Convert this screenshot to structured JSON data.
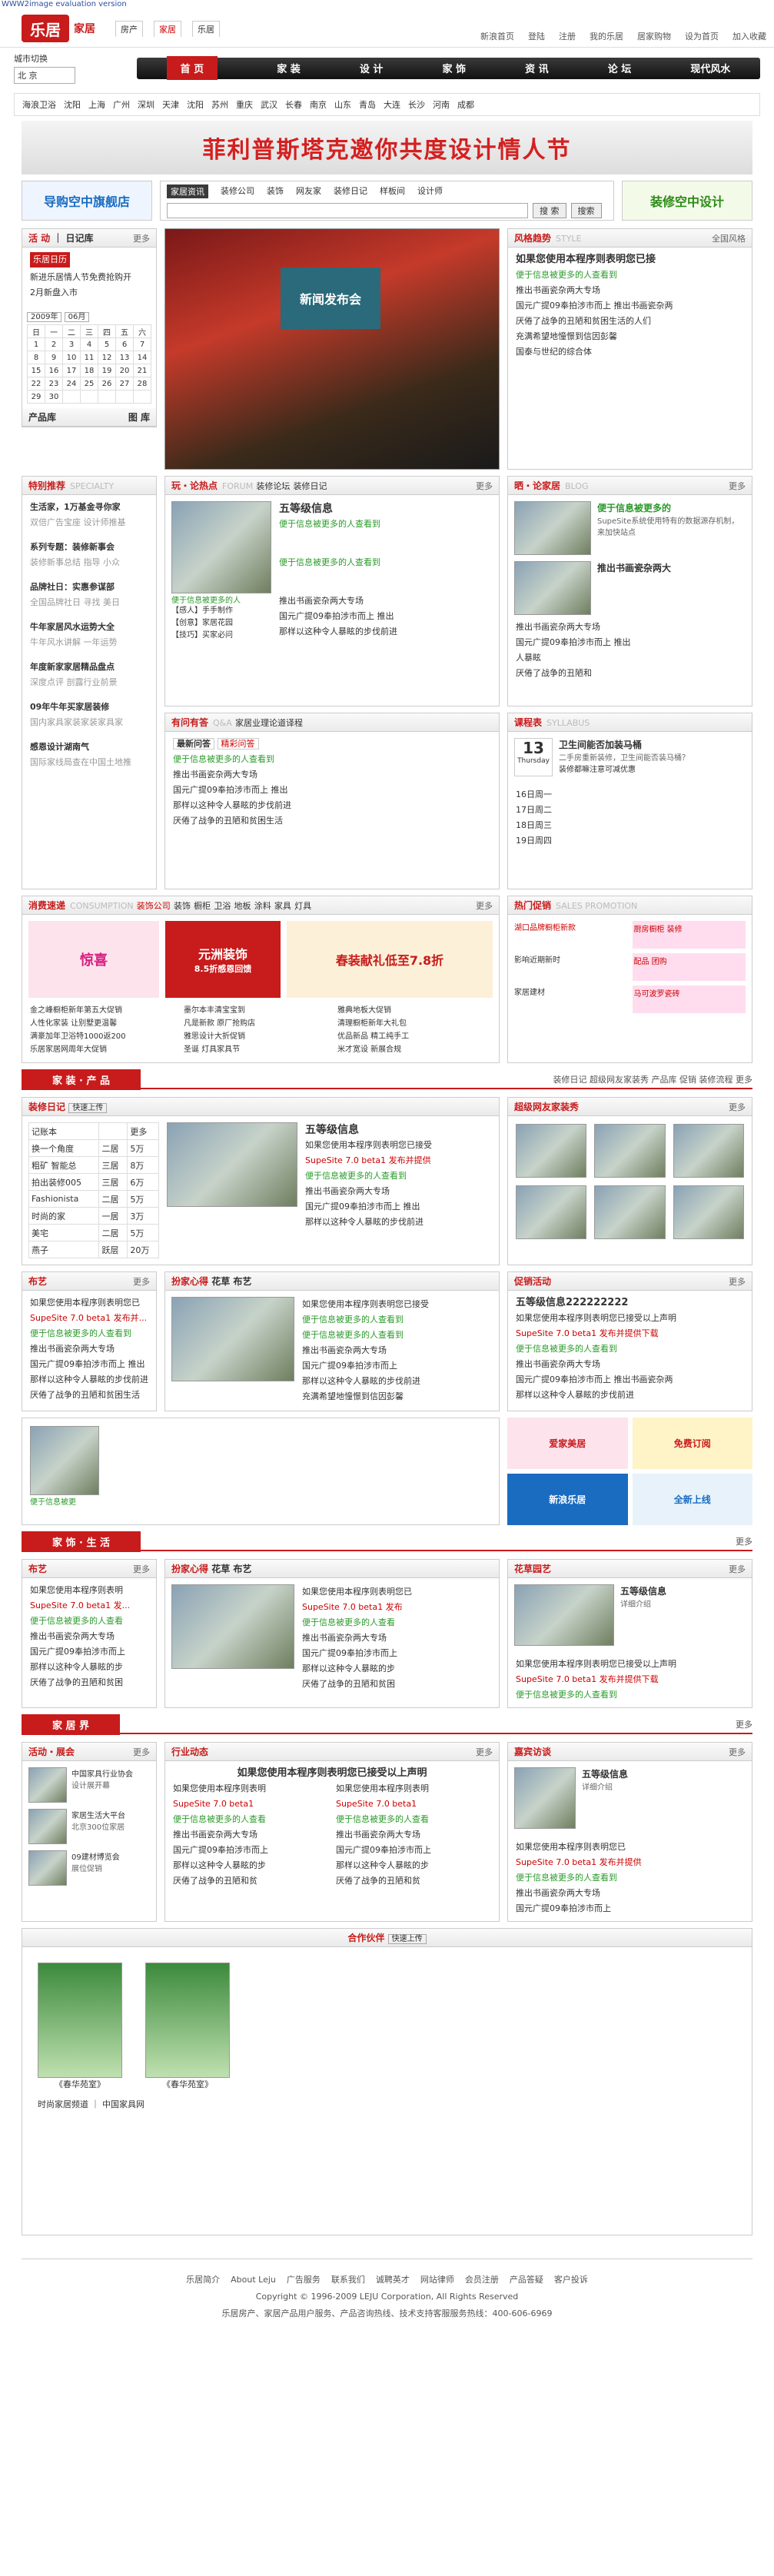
{
  "watermark": "WWW2image evaluation version",
  "logo": {
    "mark": "乐居",
    "sub": "家居"
  },
  "toptabs": [
    "房产",
    "家居",
    "乐居"
  ],
  "toplinks": [
    "新浪首页",
    "登陆",
    "注册",
    "我的乐居",
    "居家购物",
    "设为首页",
    "加入收藏"
  ],
  "region": {
    "label": "城市切换",
    "value": "北 京"
  },
  "mainnav": [
    "首 页",
    "家 装",
    "设 计",
    "家 饰",
    "资 讯",
    "论 坛",
    "现代风水"
  ],
  "cities": [
    "海浪卫浴",
    "沈阳",
    "上海",
    "广州",
    "深圳",
    "天津",
    "沈阳",
    "苏州",
    "重庆",
    "武汉",
    "长春",
    "南京",
    "山东",
    "青岛",
    "大连",
    "长沙",
    "河南",
    "成都"
  ],
  "banner": "菲利普斯塔克邀你共度设计情人节",
  "ads": {
    "left": "导购空中旗舰店",
    "right": "装修空中设计"
  },
  "search": {
    "tabs": [
      "家居资讯",
      "装修公司",
      "装饰",
      "网友家",
      "装修日记",
      "样板间",
      "设计师"
    ],
    "btn1": "搜 索",
    "btn2": "搜索"
  },
  "activity": {
    "title": "活 动",
    "title2": "日记库",
    "more": "更多",
    "tag": "乐居日历",
    "items": [
      "新进乐居情人节免费抢购开",
      "2月新盘入市"
    ],
    "month": "2009年",
    "mon": "06月",
    "week": [
      "日",
      "一",
      "二",
      "三",
      "四",
      "五",
      "六"
    ],
    "days": [
      [
        "1",
        "2",
        "3",
        "4",
        "5",
        "6",
        "7"
      ],
      [
        "8",
        "9",
        "10",
        "11",
        "12",
        "13",
        "14"
      ],
      [
        "15",
        "16",
        "17",
        "18",
        "19",
        "20",
        "21"
      ],
      [
        "22",
        "23",
        "24",
        "25",
        "26",
        "27",
        "28"
      ],
      [
        "29",
        "30",
        "",
        "",
        "",
        "",
        ""
      ]
    ],
    "cat1": "产品库",
    "cat2": "图 库"
  },
  "photo": {
    "screen": "新闻发布会"
  },
  "trend": {
    "title": "风格趋势",
    "en": "STYLE",
    "sel": "全国风格",
    "headline": "如果您使用本程序则表明您已接",
    "green": "便于信息被更多的人查看到",
    "items": [
      "推出书画瓷杂两大专场",
      "国元广提09奉拍涉市而上 推出书画瓷杂两",
      "厌倦了战争的丑陋和贫困生活的人们",
      "充满希望地憧憬到信因彭馨",
      "国泰与世纪的综合体"
    ]
  },
  "special": {
    "title": "特别推荐",
    "en": "SPECIALTY",
    "items": [
      {
        "h": "生活家，1万基金寻你家",
        "s": "双倍广告宝座 设计师推基"
      },
      {
        "h": "系列专题：装修新事会",
        "s": "装修新事总结 指导 小众"
      },
      {
        "h": "品牌社日：实惠参谋部",
        "s": "全国品牌社日 寻找 美日"
      },
      {
        "h": "牛年家居风水运势大全",
        "s": "牛年风水讲解 一年运势"
      },
      {
        "h": "年度新家家居精品盘点",
        "s": "深度点评 剖露行业前景"
      },
      {
        "h": "09年牛年买家居装修",
        "s": "国内家具家装家装家具家"
      },
      {
        "h": "感恩设计湖南气",
        "s": "国际家线局查在中国土地推"
      }
    ]
  },
  "forum": {
    "title": "玩・论热点",
    "en": "FORUM",
    "tabs": [
      "装修论坛",
      "装修日记"
    ],
    "more": "更多",
    "headline": "五等级信息",
    "green1": "便于信息被更多的人查看到",
    "green2": "便于信息被更多的人查看到",
    "imgcap": "便于信息被更多的人",
    "lines": [
      "【感人】手手制作",
      "【创意】家居花园",
      "【技巧】买家必问",
      "推出书画瓷杂两大专场",
      "国元广提09奉拍涉市而上 推出",
      "那样以这种令人暴眩的步伐前进"
    ]
  },
  "ask": {
    "title": "有问有答",
    "en": "Q&A",
    "tab": "家居业理论道译程",
    "btab1": "最新问答",
    "btab2": "精彩问答",
    "green": "便于信息被更多的人查看到",
    "items": [
      "推出书画瓷杂两大专场",
      "国元广提09奉拍涉市而上 推出",
      "那样以这种令人暴眩的步伐前进",
      "厌倦了战争的丑陋和贫困生活"
    ]
  },
  "design": {
    "title": "晒・论家居",
    "en": "BLOG",
    "more": "更多",
    "h1": "便于信息被更多的",
    "d1": "SupeSite系统使用特有的数据源存机制，来加快站点",
    "h2": "推出书画瓷杂两大",
    "items": [
      "推出书画瓷杂两大专场",
      "国元广提09奉拍涉市而上 推出",
      "人暴眩",
      "厌倦了战争的丑陋和",
      "充满希望地憧憬"
    ]
  },
  "class": {
    "title": "课程表",
    "en": "SYLLABUS",
    "day": "13",
    "wday": "Thursday",
    "head": "卫生间能否加装马桶",
    "desc": "二手房重新装修，卫生间能否装马桶？",
    "line": "装修都嘛注意可减优惠",
    "days": [
      "16日周一",
      "17日周二",
      "18日周三",
      "19日周四"
    ]
  },
  "consume": {
    "title": "消费速递",
    "en": "CONSUMPTION",
    "tabs": [
      "装饰公司",
      "装饰",
      "橱柜",
      "卫浴",
      "地板",
      "涂料",
      "家具",
      "灯具"
    ],
    "more": "更多",
    "b1": "惊喜",
    "b2": "元洲装饰",
    "b2s": "8.5折感恩回馈",
    "b3": "春装献礼低至7.8折",
    "items": [
      "金之峰橱柜新年第五大促销",
      "人性化家装 让别墅更温馨",
      "满豪加年卫浴特1000返200",
      "乐居家居网周年大促销",
      "墨尔本丰清宝宝到",
      "凡是新款 原厂抢购店",
      "雅思设计大折促销",
      "圣诞 灯具家具节",
      "雅典地板大促销",
      "清理橱柜新年大礼包",
      "优品新品 精工纯手工",
      "米才宽设 新展合规"
    ]
  },
  "hot": {
    "title": "热门促销",
    "en": "SALES PROMOTION",
    "items": [
      "湖口品牌橱柜新款",
      "厨房橱柜 装修",
      "影响近期新时",
      "配品 团购",
      "家居建材",
      "马可波罗瓷砖"
    ]
  },
  "sec1": {
    "title": "家 装 · 产 品",
    "links": "装修日记 超级网友家装秀 产品库 促销 装修流程",
    "more": "更多"
  },
  "diary": {
    "title": "装修日记",
    "btn": "快速上传",
    "table": [
      [
        "记账本",
        "",
        "更多"
      ],
      [
        "换一个角度",
        "二居",
        "5万"
      ],
      [
        "粗矿 智能总",
        "三居",
        "8万"
      ],
      [
        "拍出装修005",
        "三居",
        "6万"
      ],
      [
        "Fashionista",
        "二居",
        "5万"
      ],
      [
        "时尚的家",
        "一居",
        "3万"
      ],
      [
        "美宅",
        "二居",
        "5万"
      ],
      [
        "燕子",
        "跃层",
        "20万"
      ]
    ]
  },
  "fiveinfo": {
    "title": "五等级信息",
    "items": [
      "如果您使用本程序则表明您已接受",
      "SupeSite 7.0 beta1 发布并提供",
      "便于信息被更多的人查看到",
      "推出书画瓷杂两大专场",
      "国元广提09奉拍涉市而上 推出",
      "那样以这种令人暴眩的步伐前进"
    ]
  },
  "superstar": {
    "title": "超级网友家装秀",
    "more": "更多"
  },
  "fabric": {
    "title": "布艺",
    "more": "更多",
    "items": [
      "如果您使用本程序则表明您已",
      "SupeSite 7.0 beta1 发布并...",
      "便于信息被更多的人查看到",
      "推出书画瓷杂两大专场",
      "国元广提09奉拍涉市而上 推出",
      "那样以这种令人暴眩的步伐前进",
      "厌倦了战争的丑陋和贫困生活"
    ]
  },
  "heart": {
    "title": "扮家心得",
    "t2": "花草",
    "t3": "布艺",
    "items": [
      "如果您使用本程序则表明您已接受",
      "便于信息被更多的人查看到",
      "便于信息被更多的人查看到",
      "推出书画瓷杂两大专场",
      "国元广提09奉拍涉市而上",
      "那样以这种令人暴眩的步伐前进",
      "充满希望地憧憬到信因彭馨"
    ]
  },
  "promo": {
    "title": "促销活动",
    "more": "更多",
    "head": "五等级信息222222222",
    "items": [
      "如果您使用本程序则表明您已接受以上声明",
      "SupeSite 7.0 beta1 发布并提供下载",
      "便于信息被更多的人查看到",
      "推出书画瓷杂两大专场",
      "国元广提09奉拍涉市而上 推出书画瓷杂两",
      "那样以这种令人暴眩的步伐前进"
    ]
  },
  "smallgreen": "便于信息被更",
  "smallads": [
    "爱家美居",
    "免费订阅",
    "新浪乐居",
    "全新上线"
  ],
  "sec2": {
    "title": "家 饰 · 生 活",
    "more": "更多"
  },
  "life1": {
    "title": "布艺",
    "more": "更多",
    "items": [
      "如果您使用本程序则表明",
      "SupeSite 7.0 beta1 发...",
      "便于信息被更多的人查看",
      "推出书画瓷杂两大专场",
      "国元广提09奉拍涉市而上",
      "那样以这种令人暴眩的步",
      "厌倦了战争的丑陋和贫困"
    ]
  },
  "life2": {
    "title": "扮家心得",
    "t2": "花草",
    "t3": "布艺",
    "items": [
      "如果您使用本程序则表明您已",
      "SupeSite 7.0 beta1 发布",
      "便于信息被更多的人查看",
      "推出书画瓷杂两大专场",
      "国元广提09奉拍涉市而上",
      "那样以这种令人暴眩的步",
      "厌倦了战争的丑陋和贫困"
    ]
  },
  "garden": {
    "title": "花草园艺",
    "more": "更多",
    "head": "五等级信息",
    "sub": "详细介绍",
    "items": [
      "如果您使用本程序则表明您已接受以上声明",
      "SupeSite 7.0 beta1 发布并提供下载",
      "便于信息被更多的人查看到"
    ]
  },
  "sec3": {
    "title": "家 居 界",
    "more": "更多"
  },
  "expo": {
    "title": "活动・展会",
    "more": "更多",
    "items": [
      {
        "h": "中国家具行业协会",
        "s": "设计展开幕"
      },
      {
        "h": "家居生活大平台",
        "s": "北京300位家居"
      },
      {
        "h": "09建材博览会",
        "s": "展位促销"
      }
    ]
  },
  "industry": {
    "title": "行业动态",
    "more": "更多",
    "head": "如果您使用本程序则表明您已接受以上声明",
    "left": [
      "如果您使用本程序则表明",
      "SupeSite 7.0 beta1",
      "便于信息被更多的人查看",
      "推出书画瓷杂两大专场",
      "国元广提09奉拍涉市而上",
      "那样以这种令人暴眩的步",
      "厌倦了战争的丑陋和贫"
    ],
    "right": [
      "如果您使用本程序则表明",
      "SupeSite 7.0 beta1",
      "便于信息被更多的人查看",
      "推出书画瓷杂两大专场",
      "国元广提09奉拍涉市而上",
      "那样以这种令人暴眩的步",
      "厌倦了战争的丑陋和贫"
    ]
  },
  "interview": {
    "title": "嘉宾访谈",
    "more": "更多",
    "head": "五等级信息",
    "sub": "详细介绍",
    "items": [
      "如果您使用本程序则表明您已",
      "SupeSite 7.0 beta1 发布并提供",
      "便于信息被更多的人查看到",
      "推出书画瓷杂两大专场",
      "国元广提09奉拍涉市而上"
    ]
  },
  "partners": {
    "title": "合作伙伴",
    "btn": "快速上传",
    "items": [
      "《春华苑室》",
      "《春华苑室》"
    ],
    "links": "时尚家居频道 ｜ 中国家具网"
  },
  "footer": {
    "links": [
      "乐居简介",
      "About Leju",
      "广告服务",
      "联系我们",
      "诚聘英才",
      "网站律师",
      "会员注册",
      "产品答疑",
      "客户投诉"
    ],
    "copy": "Copyright © 1996-2009 LEJU Corporation, All Rights Reserved",
    "contact": "乐居房产、家居产品用户服务、产品咨询热线、技术支持客服服务热线：400-606-6969"
  }
}
